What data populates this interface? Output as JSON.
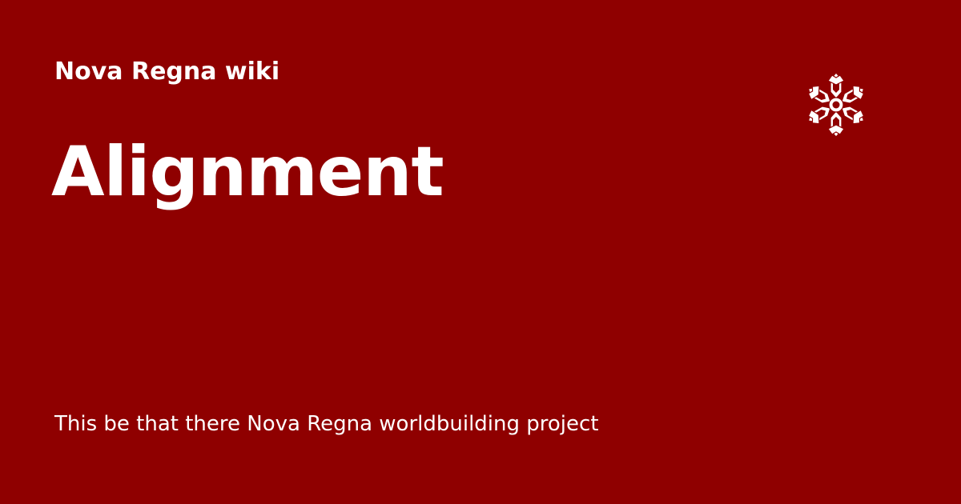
{
  "site": {
    "name": "Nova Regna wiki",
    "logo_icon": "snowflake-hexagon-logo-icon"
  },
  "page": {
    "title": "Alignment",
    "description": "This be that there Nova Regna worldbuilding project"
  },
  "colors": {
    "background": "#8f0000",
    "text": "#ffffff"
  }
}
